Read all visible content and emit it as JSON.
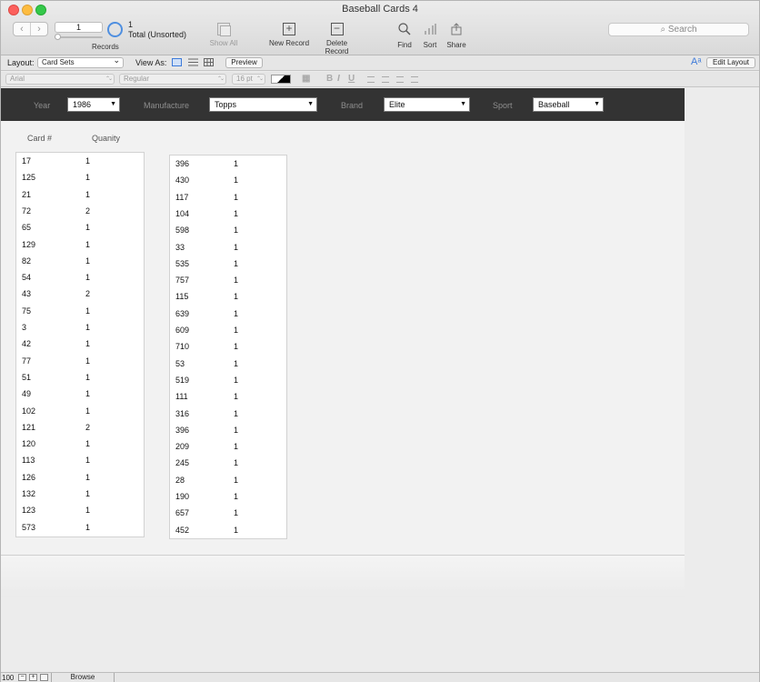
{
  "window": {
    "title": "Baseball Cards 4"
  },
  "toolbar": {
    "current_record": "1",
    "records_label": "Records",
    "found_count": "1",
    "found_status": "Total (Unsorted)",
    "show_all_label": "Show All",
    "new_record_label": "New Record",
    "delete_record_label": "Delete Record",
    "find_label": "Find",
    "sort_label": "Sort",
    "share_label": "Share",
    "search_placeholder": "Search"
  },
  "layoutbar": {
    "layout_label": "Layout:",
    "layout_value": "Card Sets",
    "view_as_label": "View As:",
    "preview_label": "Preview",
    "edit_layout_label": "Edit Layout"
  },
  "formatbar": {
    "font": "Arial",
    "style": "Regular",
    "size": "16 pt"
  },
  "filters": {
    "year_label": "Year",
    "year_value": "1986",
    "manufacture_label": "Manufacture",
    "manufacture_value": "Topps",
    "brand_label": "Brand",
    "brand_value": "Elite",
    "sport_label": "Sport",
    "sport_value": "Baseball"
  },
  "columns": {
    "card_label": "Card #",
    "quantity_label": "Quanity"
  },
  "portal_left": [
    [
      "17",
      "1"
    ],
    [
      "125",
      "1"
    ],
    [
      "21",
      "1"
    ],
    [
      "72",
      "2"
    ],
    [
      "65",
      "1"
    ],
    [
      "129",
      "1"
    ],
    [
      "82",
      "1"
    ],
    [
      "54",
      "1"
    ],
    [
      "43",
      "2"
    ],
    [
      "75",
      "1"
    ],
    [
      "3",
      "1"
    ],
    [
      "42",
      "1"
    ],
    [
      "77",
      "1"
    ],
    [
      "51",
      "1"
    ],
    [
      "49",
      "1"
    ],
    [
      "102",
      "1"
    ],
    [
      "121",
      "2"
    ],
    [
      "120",
      "1"
    ],
    [
      "113",
      "1"
    ],
    [
      "126",
      "1"
    ],
    [
      "132",
      "1"
    ],
    [
      "123",
      "1"
    ],
    [
      "573",
      "1"
    ]
  ],
  "portal_right": [
    [
      "396",
      "1"
    ],
    [
      "430",
      "1"
    ],
    [
      "117",
      "1"
    ],
    [
      "104",
      "1"
    ],
    [
      "598",
      "1"
    ],
    [
      "33",
      "1"
    ],
    [
      "535",
      "1"
    ],
    [
      "757",
      "1"
    ],
    [
      "115",
      "1"
    ],
    [
      "639",
      "1"
    ],
    [
      "609",
      "1"
    ],
    [
      "710",
      "1"
    ],
    [
      "53",
      "1"
    ],
    [
      "519",
      "1"
    ],
    [
      "111",
      "1"
    ],
    [
      "316",
      "1"
    ],
    [
      "396",
      "1"
    ],
    [
      "209",
      "1"
    ],
    [
      "245",
      "1"
    ],
    [
      "28",
      "1"
    ],
    [
      "190",
      "1"
    ],
    [
      "657",
      "1"
    ],
    [
      "452",
      "1"
    ]
  ],
  "statusbar": {
    "zoom": "100",
    "mode": "Browse"
  }
}
